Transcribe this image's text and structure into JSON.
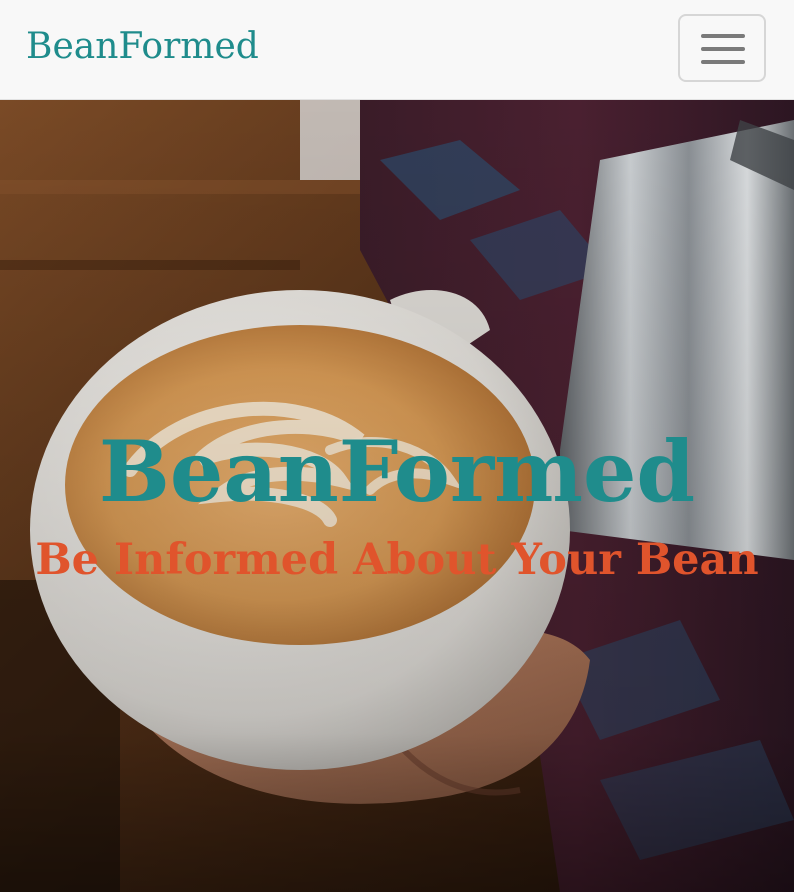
{
  "navbar": {
    "brand": "BeanFormed",
    "toggle_icon": "hamburger-menu-icon"
  },
  "hero": {
    "title": "BeanFormed",
    "subtitle": "Be Informed About Your Bean",
    "image": "latte-art-pour-photo"
  },
  "colors": {
    "brand_teal": "#1f8c8c",
    "accent_orange": "#e0542c",
    "navbar_bg": "#f8f8f8"
  }
}
